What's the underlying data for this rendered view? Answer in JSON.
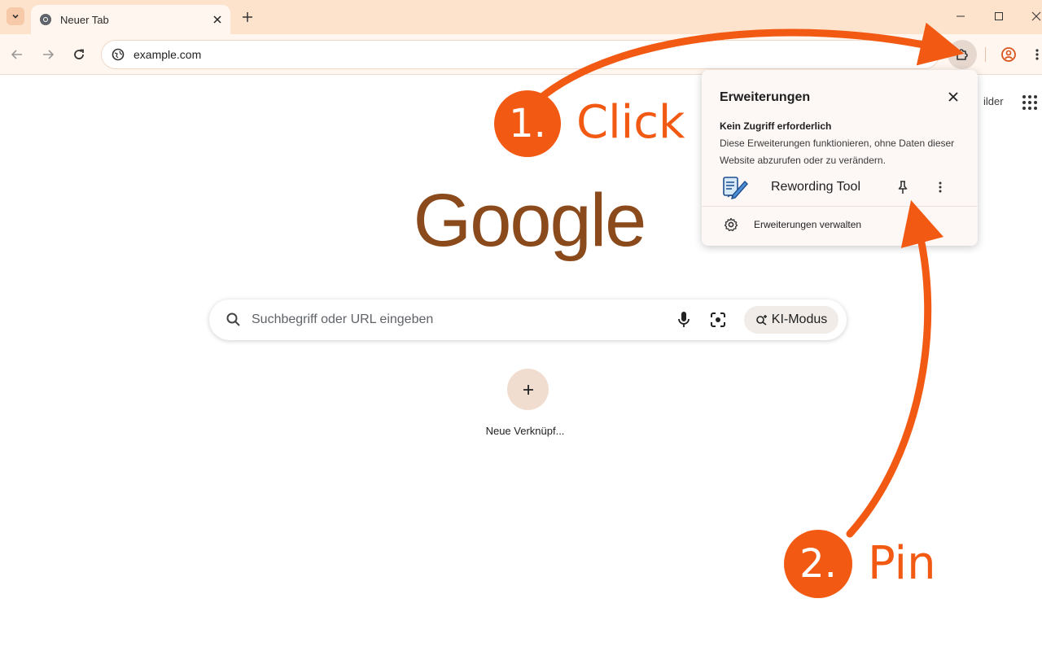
{
  "browser": {
    "tab_title": "Neuer Tab",
    "url": "example.com"
  },
  "ntp": {
    "images_link": "ilder",
    "logo": "Google",
    "search_placeholder": "Suchbegriff oder URL eingeben",
    "ki_mode_label": "KI-Modus",
    "shortcut_label": "Neue Verknüpf..."
  },
  "extensions_popup": {
    "title": "Erweiterungen",
    "section_title": "Kein Zugriff erforderlich",
    "section_desc": "Diese Erweiterungen funktionieren, ohne Daten dieser Website abzurufen oder zu verändern.",
    "extension_name": "Rewording Tool",
    "manage_label": "Erweiterungen verwalten"
  },
  "annotations": {
    "step1_number": "1.",
    "step1_label": "Click",
    "step2_number": "2.",
    "step2_label": "Pin",
    "accent_color": "#f25a14"
  },
  "theme": {
    "tabstrip_bg": "#fde2cc",
    "toolbar_bg": "#fff6ef",
    "logo_color": "#8a4a1c"
  }
}
